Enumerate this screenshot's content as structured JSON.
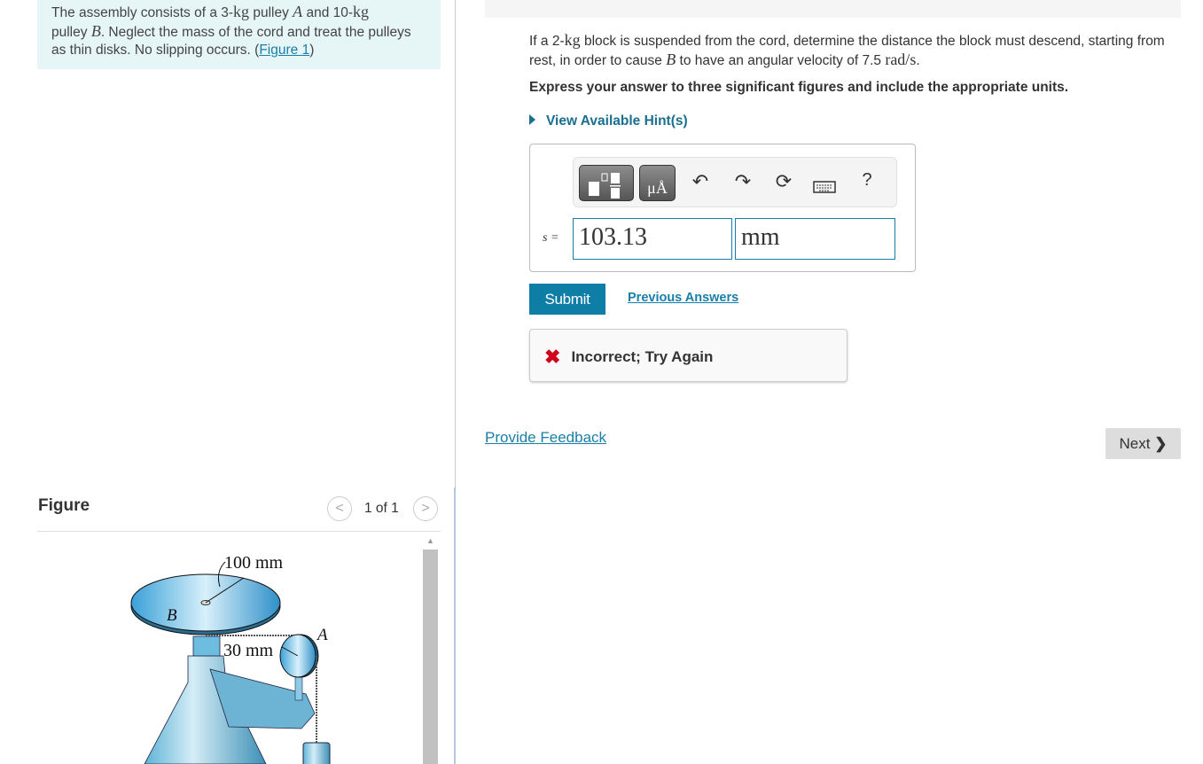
{
  "intro": {
    "t1": "The assembly consists of a 3-",
    "kg": "kg",
    "t2": " pulley ",
    "A": "A",
    "t3": " and 10-",
    "t4": "pulley ",
    "B": "B",
    "t5": ". Neglect the mass of the cord and treat the pulleys as thin disks. No slipping occurs. (",
    "link": "Figure 1",
    "t6": ")"
  },
  "question": {
    "t1": "If a 2-",
    "kg": "kg",
    "t2": " block is suspended from the cord, determine the distance the block must descend, starting from rest, in order to cause ",
    "B": "B",
    "t3": " to have an angular velocity of 7.5 ",
    "unit": "rad/s",
    "t4": "."
  },
  "instructions": "Express your answer to three significant figures and include the appropriate units.",
  "hint": "View Available Hint(s)",
  "answer": {
    "label": "s =",
    "value": "103.13",
    "units": "mm",
    "toolbar": [
      "templates-icon",
      "units-icon",
      "undo-icon",
      "redo-icon",
      "reset-icon",
      "keyboard-icon",
      "help-icon"
    ],
    "units_button": "μÅ",
    "help": "?"
  },
  "submit": "Submit",
  "previous_answers": "Previous Answers",
  "feedback": {
    "text": "Incorrect; Try Again",
    "color": "#d0021b"
  },
  "provide_feedback": "Provide Feedback",
  "next": "Next",
  "figure": {
    "title": "Figure",
    "counter": "1 of 1",
    "labels": {
      "r_b": "100 mm",
      "r_a": "30 mm",
      "A": "A",
      "B": "B"
    }
  },
  "colors": {
    "accent": "#0f7ea6",
    "intro_bg": "#e6f5f6"
  }
}
